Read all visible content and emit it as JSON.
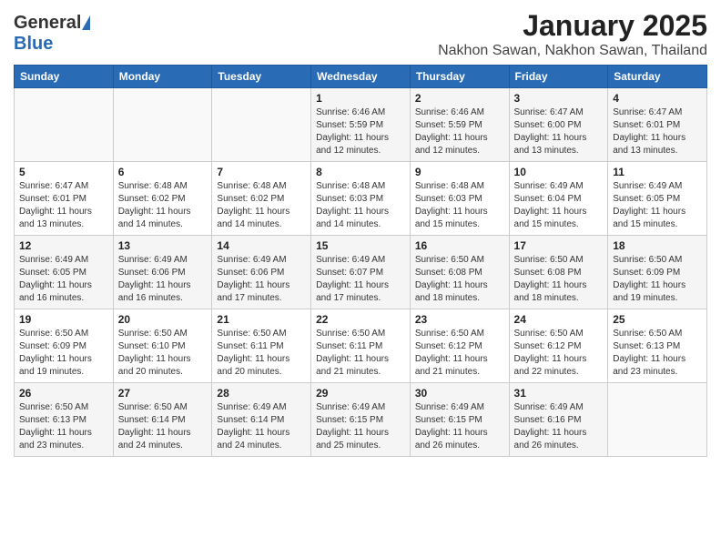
{
  "header": {
    "logo_general": "General",
    "logo_blue": "Blue",
    "month_title": "January 2025",
    "location": "Nakhon Sawan, Nakhon Sawan, Thailand"
  },
  "weekdays": [
    "Sunday",
    "Monday",
    "Tuesday",
    "Wednesday",
    "Thursday",
    "Friday",
    "Saturday"
  ],
  "weeks": [
    [
      {
        "day": "",
        "info": ""
      },
      {
        "day": "",
        "info": ""
      },
      {
        "day": "",
        "info": ""
      },
      {
        "day": "1",
        "info": "Sunrise: 6:46 AM\nSunset: 5:59 PM\nDaylight: 11 hours\nand 12 minutes."
      },
      {
        "day": "2",
        "info": "Sunrise: 6:46 AM\nSunset: 5:59 PM\nDaylight: 11 hours\nand 12 minutes."
      },
      {
        "day": "3",
        "info": "Sunrise: 6:47 AM\nSunset: 6:00 PM\nDaylight: 11 hours\nand 13 minutes."
      },
      {
        "day": "4",
        "info": "Sunrise: 6:47 AM\nSunset: 6:01 PM\nDaylight: 11 hours\nand 13 minutes."
      }
    ],
    [
      {
        "day": "5",
        "info": "Sunrise: 6:47 AM\nSunset: 6:01 PM\nDaylight: 11 hours\nand 13 minutes."
      },
      {
        "day": "6",
        "info": "Sunrise: 6:48 AM\nSunset: 6:02 PM\nDaylight: 11 hours\nand 14 minutes."
      },
      {
        "day": "7",
        "info": "Sunrise: 6:48 AM\nSunset: 6:02 PM\nDaylight: 11 hours\nand 14 minutes."
      },
      {
        "day": "8",
        "info": "Sunrise: 6:48 AM\nSunset: 6:03 PM\nDaylight: 11 hours\nand 14 minutes."
      },
      {
        "day": "9",
        "info": "Sunrise: 6:48 AM\nSunset: 6:03 PM\nDaylight: 11 hours\nand 15 minutes."
      },
      {
        "day": "10",
        "info": "Sunrise: 6:49 AM\nSunset: 6:04 PM\nDaylight: 11 hours\nand 15 minutes."
      },
      {
        "day": "11",
        "info": "Sunrise: 6:49 AM\nSunset: 6:05 PM\nDaylight: 11 hours\nand 15 minutes."
      }
    ],
    [
      {
        "day": "12",
        "info": "Sunrise: 6:49 AM\nSunset: 6:05 PM\nDaylight: 11 hours\nand 16 minutes."
      },
      {
        "day": "13",
        "info": "Sunrise: 6:49 AM\nSunset: 6:06 PM\nDaylight: 11 hours\nand 16 minutes."
      },
      {
        "day": "14",
        "info": "Sunrise: 6:49 AM\nSunset: 6:06 PM\nDaylight: 11 hours\nand 17 minutes."
      },
      {
        "day": "15",
        "info": "Sunrise: 6:49 AM\nSunset: 6:07 PM\nDaylight: 11 hours\nand 17 minutes."
      },
      {
        "day": "16",
        "info": "Sunrise: 6:50 AM\nSunset: 6:08 PM\nDaylight: 11 hours\nand 18 minutes."
      },
      {
        "day": "17",
        "info": "Sunrise: 6:50 AM\nSunset: 6:08 PM\nDaylight: 11 hours\nand 18 minutes."
      },
      {
        "day": "18",
        "info": "Sunrise: 6:50 AM\nSunset: 6:09 PM\nDaylight: 11 hours\nand 19 minutes."
      }
    ],
    [
      {
        "day": "19",
        "info": "Sunrise: 6:50 AM\nSunset: 6:09 PM\nDaylight: 11 hours\nand 19 minutes."
      },
      {
        "day": "20",
        "info": "Sunrise: 6:50 AM\nSunset: 6:10 PM\nDaylight: 11 hours\nand 20 minutes."
      },
      {
        "day": "21",
        "info": "Sunrise: 6:50 AM\nSunset: 6:11 PM\nDaylight: 11 hours\nand 20 minutes."
      },
      {
        "day": "22",
        "info": "Sunrise: 6:50 AM\nSunset: 6:11 PM\nDaylight: 11 hours\nand 21 minutes."
      },
      {
        "day": "23",
        "info": "Sunrise: 6:50 AM\nSunset: 6:12 PM\nDaylight: 11 hours\nand 21 minutes."
      },
      {
        "day": "24",
        "info": "Sunrise: 6:50 AM\nSunset: 6:12 PM\nDaylight: 11 hours\nand 22 minutes."
      },
      {
        "day": "25",
        "info": "Sunrise: 6:50 AM\nSunset: 6:13 PM\nDaylight: 11 hours\nand 23 minutes."
      }
    ],
    [
      {
        "day": "26",
        "info": "Sunrise: 6:50 AM\nSunset: 6:13 PM\nDaylight: 11 hours\nand 23 minutes."
      },
      {
        "day": "27",
        "info": "Sunrise: 6:50 AM\nSunset: 6:14 PM\nDaylight: 11 hours\nand 24 minutes."
      },
      {
        "day": "28",
        "info": "Sunrise: 6:49 AM\nSunset: 6:14 PM\nDaylight: 11 hours\nand 24 minutes."
      },
      {
        "day": "29",
        "info": "Sunrise: 6:49 AM\nSunset: 6:15 PM\nDaylight: 11 hours\nand 25 minutes."
      },
      {
        "day": "30",
        "info": "Sunrise: 6:49 AM\nSunset: 6:15 PM\nDaylight: 11 hours\nand 26 minutes."
      },
      {
        "day": "31",
        "info": "Sunrise: 6:49 AM\nSunset: 6:16 PM\nDaylight: 11 hours\nand 26 minutes."
      },
      {
        "day": "",
        "info": ""
      }
    ]
  ]
}
